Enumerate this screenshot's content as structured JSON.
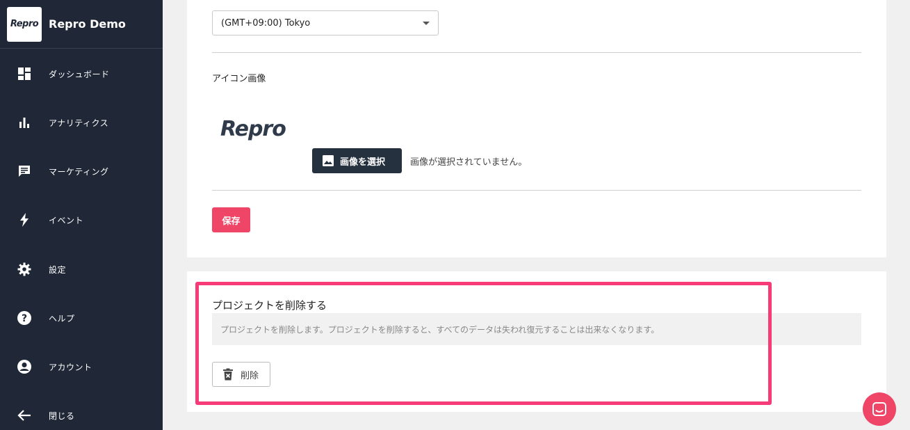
{
  "brand": {
    "logo_text": "Repro",
    "name": "Repro Demo"
  },
  "sidebar": {
    "items": [
      {
        "label": "ダッシュボード",
        "icon": "dashboard-icon"
      },
      {
        "label": "アナリティクス",
        "icon": "bar-chart-icon"
      },
      {
        "label": "マーケティング",
        "icon": "message-icon"
      },
      {
        "label": "イベント",
        "icon": "bolt-icon"
      },
      {
        "label": "設定",
        "icon": "gear-icon"
      },
      {
        "label": "ヘルプ",
        "icon": "help-icon"
      },
      {
        "label": "アカウント",
        "icon": "account-icon"
      },
      {
        "label": "閉じる",
        "icon": "arrow-left-icon"
      }
    ]
  },
  "settings": {
    "timezone_value": "(GMT+09:00) Tokyo",
    "icon_section_title": "アイコン画像",
    "icon_logo_text": "Repro",
    "select_image_label": "画像を選択",
    "no_image_text": "画像が選択されていません。",
    "save_label": "保存"
  },
  "delete_project": {
    "title": "プロジェクトを削除する",
    "description": "プロジェクトを削除します。プロジェクトを削除すると、すべてのデータは失われ復元することは出来なくなります。",
    "delete_label": "削除"
  },
  "colors": {
    "sidebar_bg": "#202837",
    "accent": "#ef4566",
    "highlight": "#f73a78",
    "dark_button": "#263140"
  }
}
